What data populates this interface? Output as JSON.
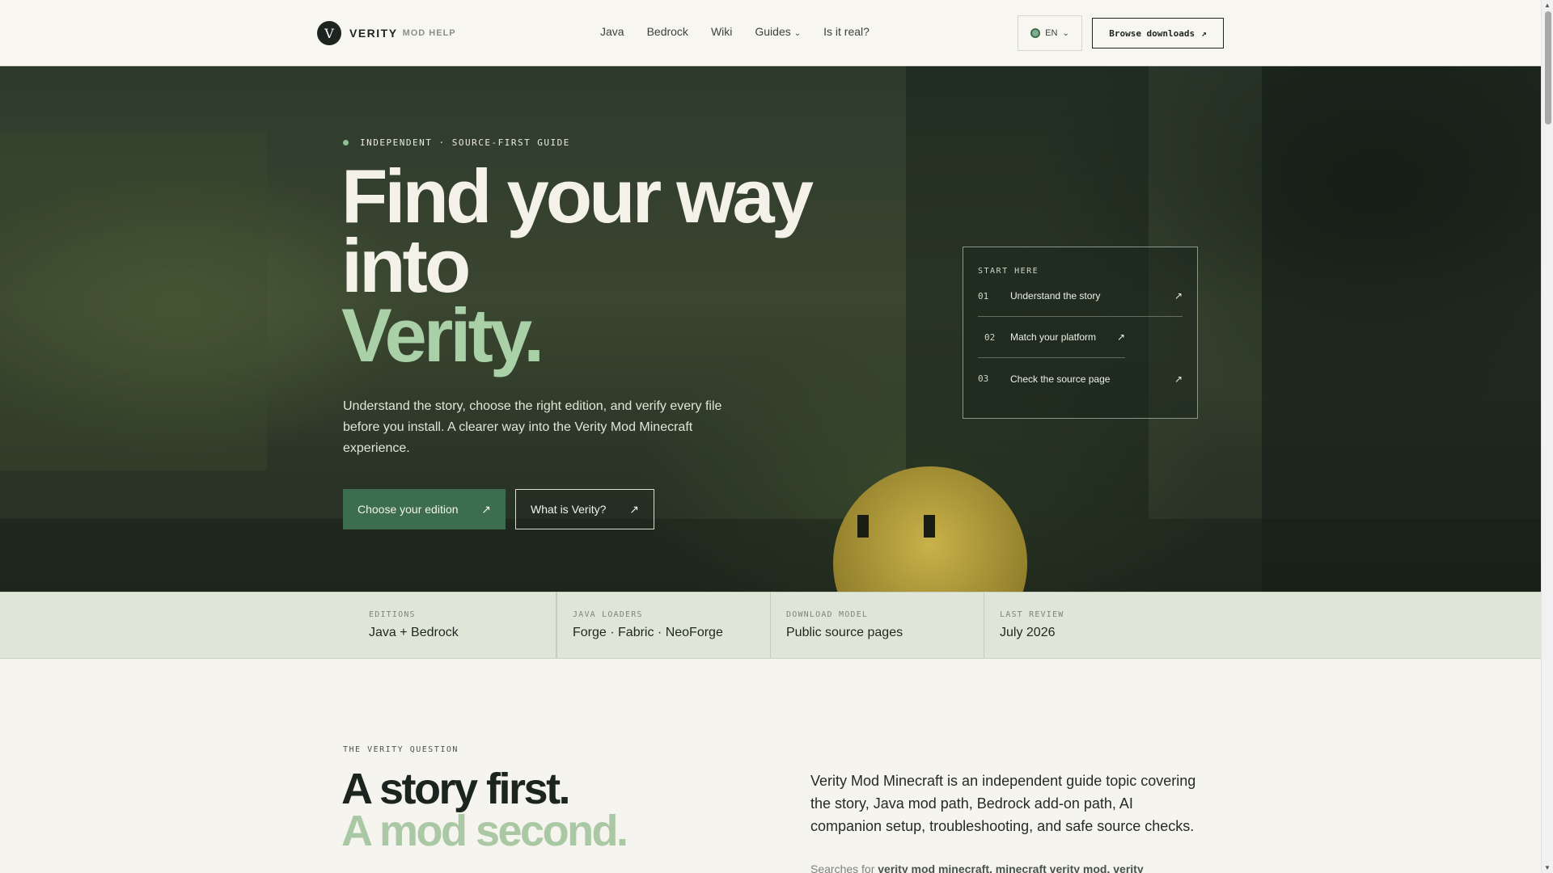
{
  "header": {
    "logo_letter": "V",
    "logo_name": "VERITY",
    "logo_sub": "MOD HELP",
    "nav": [
      "Java",
      "Bedrock",
      "Wiki",
      "Guides",
      "Is it real?"
    ],
    "lang": "EN",
    "browse_label": "Browse downloads",
    "browse_icon": "arrow-up-right-icon"
  },
  "hero": {
    "eyebrow": "INDEPENDENT · SOURCE-FIRST GUIDE",
    "title_line1": "Find your way",
    "title_line2": "into",
    "title_accent": "Verity.",
    "copy": "Understand the story, choose the right edition, and verify every file before you install. A clearer way into the Verity Mod Minecraft experience.",
    "primary_button": "Choose your edition",
    "secondary_button": "What is Verity?",
    "start": {
      "title": "START HERE",
      "items": [
        {
          "num": "01",
          "label": "Understand the story"
        },
        {
          "num": "02",
          "label": "Match your platform"
        },
        {
          "num": "03",
          "label": "Check the source page"
        }
      ]
    }
  },
  "stats": [
    {
      "label": "EDITIONS",
      "value": "Java + Bedrock"
    },
    {
      "label": "JAVA LOADERS",
      "value": "Forge · Fabric · NeoForge"
    },
    {
      "label": "DOWNLOAD MODEL",
      "value": "Public source pages"
    },
    {
      "label": "LAST REVIEW",
      "value": "July 2026"
    }
  ],
  "question": {
    "eyebrow": "THE VERITY QUESTION",
    "title_line1": "A story first.",
    "title_line2": "A mod second.",
    "copy": "Verity Mod Minecraft is an independent guide topic covering the story, Java mod path, Bedrock add-on path, AI companion setup, troubleshooting, and safe source checks.",
    "searches_prefix": "Searches for",
    "searches_terms": "verity mod minecraft, minecraft verity mod, verity"
  },
  "colors": {
    "accent_green": "#3b6d4e",
    "accent_light": "#a9d0a6",
    "strip_bg": "#dfe6d8"
  }
}
